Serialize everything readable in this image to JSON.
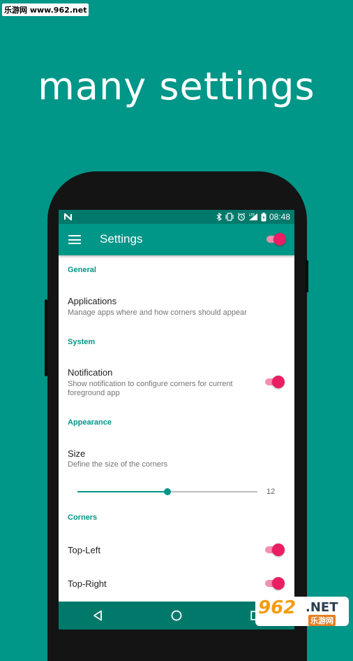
{
  "watermark": "乐游网 www.962.net",
  "headline": "many settings",
  "status_bar": {
    "time": "08:48",
    "icons": [
      "n-icon",
      "bluetooth-icon",
      "vibrate-icon",
      "alarm-icon",
      "lte-signal-icon",
      "battery-icon"
    ]
  },
  "app_bar": {
    "title": "Settings",
    "master_switch_on": true
  },
  "sections": {
    "general": "General",
    "system": "System",
    "appearance": "Appearance",
    "corners": "Corners"
  },
  "items": {
    "applications": {
      "title": "Applications",
      "subtitle": "Manage apps where and how corners should appear"
    },
    "notification": {
      "title": "Notification",
      "subtitle": "Show notification to configure corners for current foreground app",
      "on": true
    },
    "size": {
      "title": "Size",
      "subtitle": "Define the size of the corners",
      "value": "12",
      "fraction": 0.5
    },
    "top_left": {
      "title": "Top-Left",
      "on": true
    },
    "top_right": {
      "title": "Top-Right",
      "on": true
    }
  },
  "logo": {
    "number": "962",
    "suffix": ".NET",
    "chinese": "乐游网"
  },
  "colors": {
    "teal": "#009688",
    "dark_teal": "#00796b",
    "accent": "#e91e63",
    "accent_light": "#f48fb1"
  }
}
